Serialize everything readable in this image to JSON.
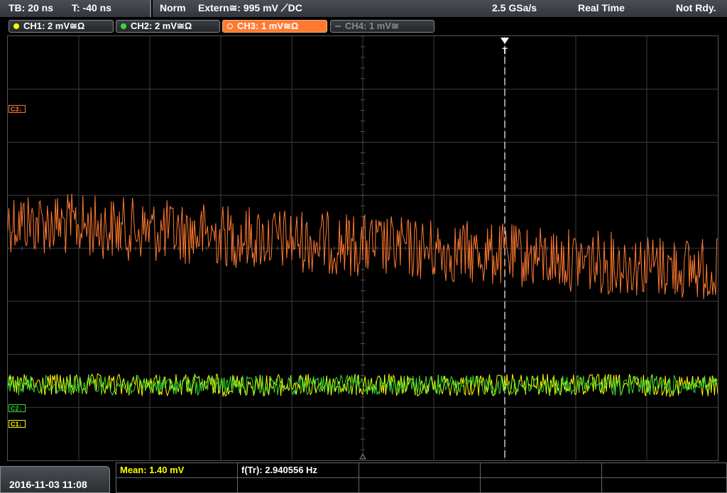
{
  "status": {
    "timebase": "TB: 20 ns",
    "trigger_pos": "T: -40 ns",
    "mode": "Norm",
    "trigger_source": "Extern≅: 995 mV ⟋DC",
    "sample_rate": "2.5 GSa/s",
    "acq": "Real Time",
    "state": "Not Rdy."
  },
  "channels": [
    {
      "label": "CH1: 2 mV≅Ω",
      "color": "#ffff00",
      "active": false,
      "enabled": true
    },
    {
      "label": "CH2: 2 mV≅Ω",
      "color": "#33dd33",
      "active": false,
      "enabled": true
    },
    {
      "label": "CH3: 1 mV≅Ω",
      "color": "#ff7a30",
      "active": true,
      "enabled": true
    },
    {
      "label": "CH4: 1 mV≅",
      "color": "#7a7a7a",
      "active": false,
      "enabled": false
    }
  ],
  "markers": {
    "c3": "C3",
    "c2": "C2",
    "c1": "C1",
    "trigger": "T"
  },
  "measurements": {
    "mean": "Mean: 1.40 mV",
    "freq": "f(Tr): 2.940556 Hz"
  },
  "datetime": "2016-11-03 11:08",
  "colors": {
    "ch1": "#ffff00",
    "ch2": "#33dd33",
    "ch3": "#ff7a30",
    "grid": "#3c3c3c"
  }
}
